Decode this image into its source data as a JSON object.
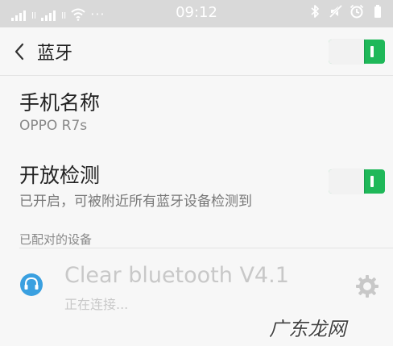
{
  "status_bar": {
    "sim1_label": "ll",
    "sim2_label": "ll",
    "dots": "···",
    "time": "09:12"
  },
  "header": {
    "title": "蓝牙"
  },
  "phone_name": {
    "title": "手机名称",
    "value": "OPPO R7s"
  },
  "discoverable": {
    "title": "开放检测",
    "subtitle": "已开启，可被附近所有蓝牙设备检测到"
  },
  "paired_section": {
    "label": "已配对的设备"
  },
  "devices": [
    {
      "name": "Clear bluetooth V4.1",
      "status": "正在连接..."
    }
  ],
  "watermark": "广东龙网",
  "colors": {
    "toggle_on": "#1fb859",
    "device_icon": "#3aa0e0"
  }
}
